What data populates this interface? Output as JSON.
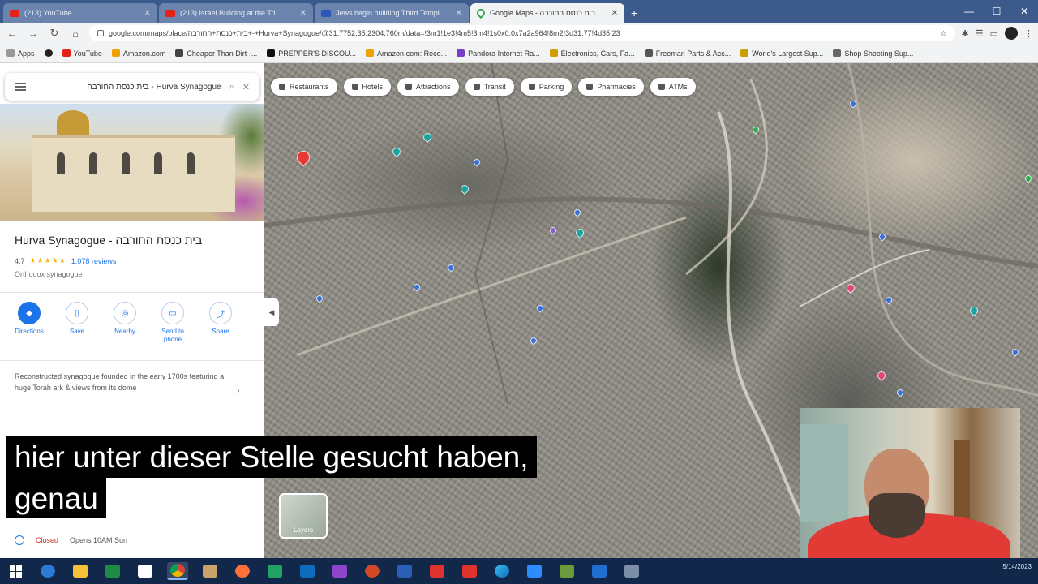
{
  "browser": {
    "tabs": [
      {
        "title": "(213) YouTube",
        "icon": "youtube-icon",
        "active": false
      },
      {
        "title": "(213) Israel Building at the Tri...",
        "icon": "youtube-icon",
        "active": false
      },
      {
        "title": "Jews begin building Third Templ...",
        "icon": "document-icon",
        "active": false
      },
      {
        "title": "Google Maps - בית כנסת החורבה",
        "icon": "maps-icon",
        "active": true
      }
    ],
    "url": "google.com/maps/place/בית+כנסת+החורבה+-+Hurva+Synagogue/@31.7752,35.2304,760m/data=!3m1!1e3!4m5!3m4!1s0x0:0x7a2a964!8m2!3d31.77!4d35.23",
    "bookmarks": [
      "Apps",
      "",
      "YouTube",
      "Amazon.com",
      "Cheaper Than Dirt -...",
      "PREPPER'S DISCOU...",
      "Amazon.com: Reco...",
      "Pandora Internet Ra...",
      "Electronics, Cars, Fa...",
      "Freeman Parts & Acc...",
      "World's Largest Sup...",
      "Shop Shooting Sup..."
    ]
  },
  "maps": {
    "search_query": "בית כנסת החורבה - Hurva Synagogue",
    "chips": [
      "Restaurants",
      "Hotels",
      "Attractions",
      "Transit",
      "Parking",
      "Pharmacies",
      "ATMs"
    ],
    "place": {
      "title": "Hurva Synagogue - בית כנסת החורבה",
      "rating": "4.7",
      "stars": "★★★★★",
      "reviews": "1,078 reviews",
      "category": "Orthodox synagogue",
      "actions": [
        "Directions",
        "Save",
        "Nearby",
        "Send to phone",
        "Share"
      ],
      "description": "Reconstructed synagogue founded in the early 1700s featuring a huge Torah ark & views from its dome",
      "status": "Closed",
      "hours": "Opens 10AM Sun"
    },
    "layers_label": "Layers"
  },
  "subtitle": {
    "line1": "hier unter dieser Stelle gesucht haben,",
    "line2": "genau"
  },
  "taskbar": {
    "time": "",
    "date": "5/14/2023"
  }
}
